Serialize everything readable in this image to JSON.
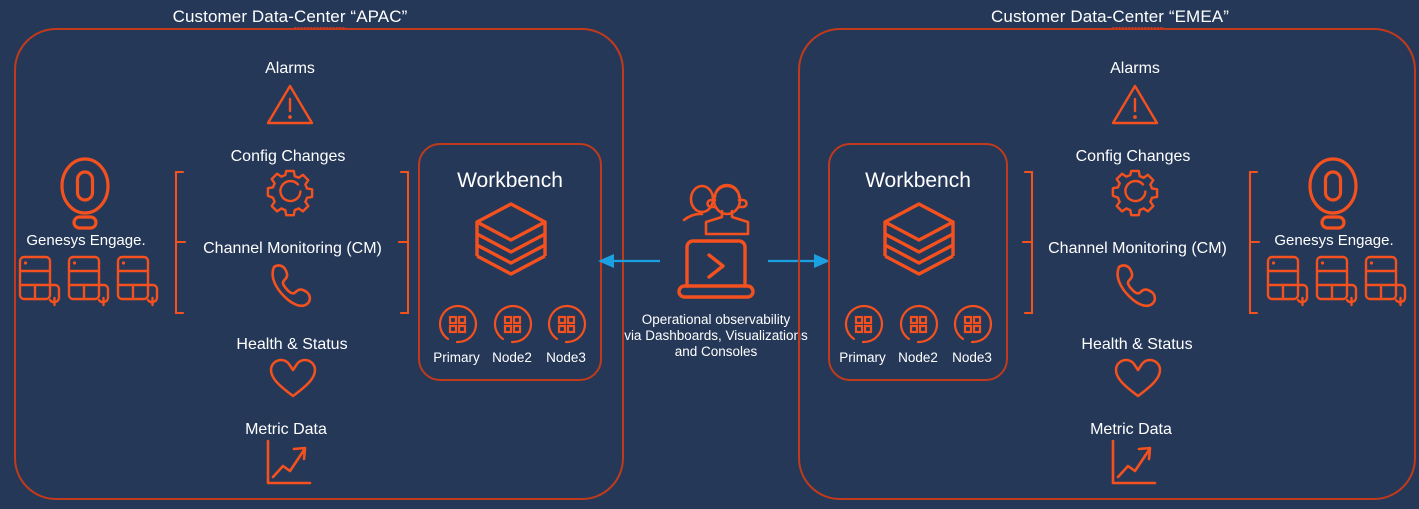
{
  "theme": {
    "background": "#253858",
    "panel_border": "#c13a1b",
    "icon_orange": "#f4511e",
    "arrow_blue": "#1ba1e2",
    "text": "#ffffff"
  },
  "panels": [
    {
      "id": "apac",
      "title": "Customer Data-Center “APAC”",
      "title_pre": "Customer Data-",
      "title_squiggle": "Center",
      "title_post": " “APAC”",
      "source_label": "Genesys Engage.",
      "source_icon": "genesys-logo-icon",
      "server_icons": [
        "server-rack-icon",
        "server-rack-icon",
        "server-rack-icon"
      ],
      "signals": [
        {
          "label": "Alarms",
          "icon": "alarm-warning-triangle-icon"
        },
        {
          "label": "Config Changes",
          "icon": "gear-icon"
        },
        {
          "label": "Channel Monitoring (CM)",
          "icon": "phone-handset-icon"
        },
        {
          "label": "Health & Status",
          "icon": "heart-icon"
        },
        {
          "label": "Metric Data",
          "icon": "metric-trend-chart-icon"
        }
      ],
      "workbench": {
        "title": "Workbench",
        "icon": "layered-stack-icon",
        "nodes": [
          {
            "label": "Primary",
            "icon": "node-cluster-icon"
          },
          {
            "label": "Node2",
            "icon": "node-cluster-icon"
          },
          {
            "label": "Node3",
            "icon": "node-cluster-icon"
          }
        ]
      }
    },
    {
      "id": "emea",
      "title": "Customer Data-Center “EMEA”",
      "title_pre": "Customer Data-",
      "title_squiggle": "Center",
      "title_post": " “EMEA”",
      "source_label": "Genesys Engage.",
      "source_icon": "genesys-logo-icon",
      "server_icons": [
        "server-rack-icon",
        "server-rack-icon",
        "server-rack-icon"
      ],
      "signals": [
        {
          "label": "Alarms",
          "icon": "alarm-warning-triangle-icon"
        },
        {
          "label": "Config Changes",
          "icon": "gear-icon"
        },
        {
          "label": "Channel Monitoring (CM)",
          "icon": "phone-handset-icon"
        },
        {
          "label": "Health & Status",
          "icon": "heart-icon"
        },
        {
          "label": "Metric Data",
          "icon": "metric-trend-chart-icon"
        }
      ],
      "workbench": {
        "title": "Workbench",
        "icon": "layered-stack-icon",
        "nodes": [
          {
            "label": "Primary",
            "icon": "node-cluster-icon"
          },
          {
            "label": "Node2",
            "icon": "node-cluster-icon"
          },
          {
            "label": "Node3",
            "icon": "node-cluster-icon"
          }
        ]
      }
    }
  ],
  "center": {
    "people_icon": "two-users-icon",
    "console_icon": "laptop-console-prompt-icon",
    "caption": "Operational observability\nvia Dashboards, Visualizations\nand Consoles",
    "arrow_left_icon": "arrow-left-icon",
    "arrow_right_icon": "arrow-right-icon"
  }
}
